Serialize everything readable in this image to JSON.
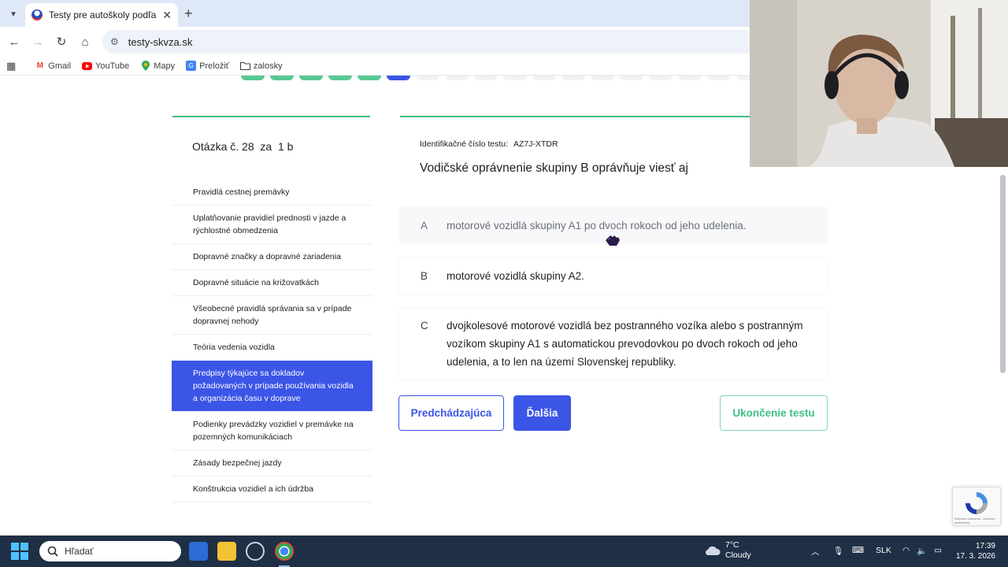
{
  "browser": {
    "tab_title": "Testy pre autoškoly podľa skup",
    "url": "testy-skvza.sk",
    "bookmarks": [
      "Gmail",
      "YouTube",
      "Mapy",
      "Preložiť",
      "zalosky"
    ]
  },
  "sidebar": {
    "question_label": "Otázka č.",
    "question_number": "28",
    "points_label": "za",
    "points": "1 b",
    "topics": [
      "Pravidlá cestnej premávky",
      "Uplatňovanie pravidiel prednosti v jazde a rýchlostné obmedzenia",
      "Dopravné značky a dopravné zariadenia",
      "Dopravné situácie na križovatkách",
      "Všeobecné pravidlá správania sa v prípade dopravnej nehody",
      "Teória vedenia vozidla",
      "Predpisy týkajúce sa dokladov požadovaných v prípade používania vozidla a organizácia času v doprave",
      "Podienky prevádzky vozidiel v premávke na pozemných komunikáciach",
      "Zásady bezpečnej jazdy",
      "Konštrukcia vozidiel a ich údržba"
    ],
    "active_topic": 6
  },
  "question": {
    "id_label": "Identifikačné číslo testu:",
    "id_value": "AZ7J-XTDR",
    "text": "Vodičské oprávnenie skupiny B oprávňuje viesť aj",
    "answers": [
      {
        "letter": "A",
        "text": "motorové vozidlá skupiny A1 po dvoch rokoch od jeho udelenia."
      },
      {
        "letter": "B",
        "text": "motorové vozidlá skupiny A2."
      },
      {
        "letter": "C",
        "text": "dvojkolesové motorové vozidlá bez postranného vozíka alebo s postranným vozíkom skupiny A1 s automatickou prevodovkou po dvoch rokoch od jeho udelenia, a to len na území Slovenskej republiky."
      }
    ]
  },
  "buttons": {
    "prev": "Predchádzajúca",
    "next": "Ďalšia",
    "end": "Ukončenie testu"
  },
  "recaptcha": {
    "fine_print": "Ochrana súkromia - Zmluvné podmienky"
  },
  "taskbar": {
    "search_placeholder": "Hľadať",
    "weather_temp": "7°C",
    "weather_desc": "Cloudy",
    "language": "SLK",
    "time": "17:39",
    "date": "17. 3. 2026"
  },
  "colors": {
    "accent_blue": "#3b55e6",
    "accent_green": "#3dbf83"
  }
}
